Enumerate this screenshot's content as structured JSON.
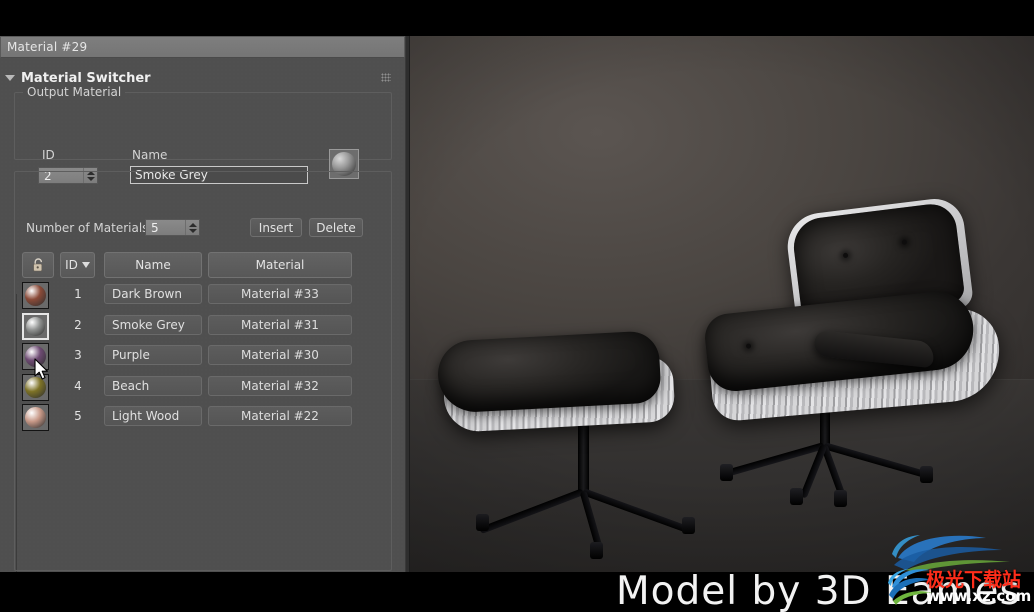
{
  "window": {
    "material_name_bar": "Material #29"
  },
  "rollout": {
    "title": "Material Switcher",
    "collapse_icon": "triangle-down-icon",
    "grip_icon": "grip-dots-icon"
  },
  "output_material": {
    "group_title": "Output Material",
    "id_label": "ID",
    "id_value": "2",
    "name_label": "Name",
    "name_value": "Smoke Grey",
    "preview_icon": "material-sphere-preview",
    "preview_color": "#9b9b9b"
  },
  "materials_controls": {
    "count_label": "Number of Materials",
    "count_value": "5",
    "insert_label": "Insert",
    "delete_label": "Delete"
  },
  "table": {
    "lock_icon": "padlock-icon",
    "columns": [
      "ID",
      "Name",
      "Material"
    ],
    "sort_icon": "sort-descending-icon",
    "rows": [
      {
        "id": "1",
        "name": "Dark Brown",
        "material": "Material #33",
        "swatch_color": "#8a4a38",
        "selected": false
      },
      {
        "id": "2",
        "name": "Smoke Grey",
        "material": "Material #31",
        "swatch_color": "#8f9190",
        "selected": true
      },
      {
        "id": "3",
        "name": "Purple",
        "material": "Material #30",
        "swatch_color": "#6d4a72",
        "selected": false
      },
      {
        "id": "4",
        "name": "Beach",
        "material": "Material #32",
        "swatch_color": "#7d7226",
        "selected": false
      },
      {
        "id": "5",
        "name": "Light Wood",
        "material": "Material #22",
        "swatch_color": "#c79887",
        "selected": false
      }
    ]
  },
  "viewport": {
    "scene_description": "3D rendered Eames lounge chair and ottoman",
    "background_color": "#4a4541"
  },
  "caption": {
    "text": "Model by 3D Eames"
  },
  "watermark": {
    "logo_icon": "swoosh-logo-icon",
    "cn_text": "极光下载站",
    "url_text": "www.xz.com",
    "cn_color": "#ff2d1a",
    "url_color": "#ffffff"
  }
}
